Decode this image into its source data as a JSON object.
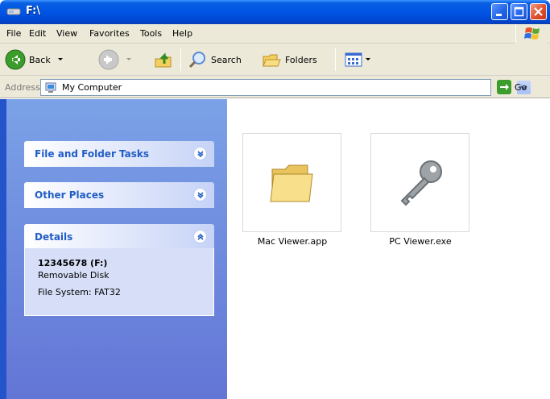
{
  "window": {
    "title": "F:\\",
    "icon": "drive-icon"
  },
  "menubar": {
    "items": [
      "File",
      "Edit",
      "View",
      "Favorites",
      "Tools",
      "Help"
    ]
  },
  "toolbar": {
    "back_label": "Back",
    "search_label": "Search",
    "folders_label": "Folders"
  },
  "address": {
    "label": "Address",
    "value": "My Computer",
    "go_label": "Go"
  },
  "tasks": {
    "file_folder": "File and Folder Tasks",
    "other_places": "Other Places",
    "details": "Details"
  },
  "details": {
    "name": "12345678 (F:)",
    "type": "Removable Disk",
    "filesystem": "File System: FAT32"
  },
  "files": [
    {
      "name": "Mac Viewer.app",
      "icon": "folder-icon"
    },
    {
      "name": "PC Viewer.exe",
      "icon": "key-icon"
    }
  ],
  "colors": {
    "titlebar": "#0055e5",
    "task_title": "#215dc6",
    "pane_bg": "#7ba2e7"
  }
}
